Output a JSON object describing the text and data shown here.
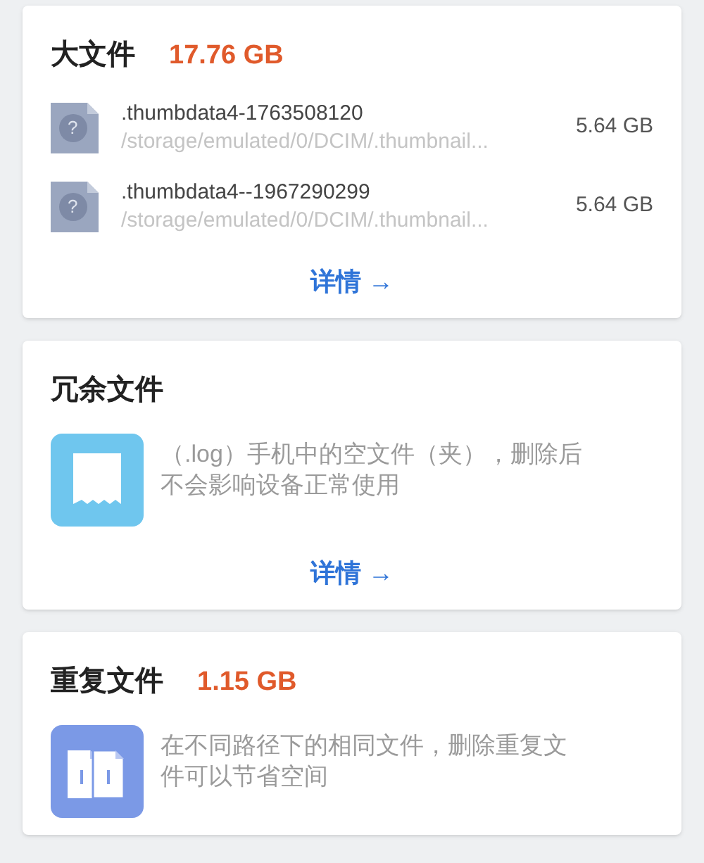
{
  "cards": [
    {
      "title": "大文件",
      "amount": "17.76 GB",
      "kind": "files",
      "files": [
        {
          "icon_glyph": "?",
          "name": ".thumbdata4-1763508120",
          "path": "/storage/emulated/0/DCIM/.thumbnail...",
          "size": "5.64 GB"
        },
        {
          "icon_glyph": "?",
          "name": ".thumbdata4--1967290299",
          "path": "/storage/emulated/0/DCIM/.thumbnail...",
          "size": "5.64 GB"
        }
      ],
      "link": "详情 →"
    },
    {
      "title": "冗余文件",
      "kind": "redundant",
      "description_lines": [
        "（.log）手机中的空文件（夹），删除后",
        "不会影响设备正常使用"
      ],
      "link": "详情 →"
    },
    {
      "title": "重复文件",
      "amount": "1.15 GB",
      "kind": "duplicate",
      "description_lines": [
        "在不同路径下的相同文件，删除重复文",
        "件可以节省空间"
      ]
    }
  ]
}
